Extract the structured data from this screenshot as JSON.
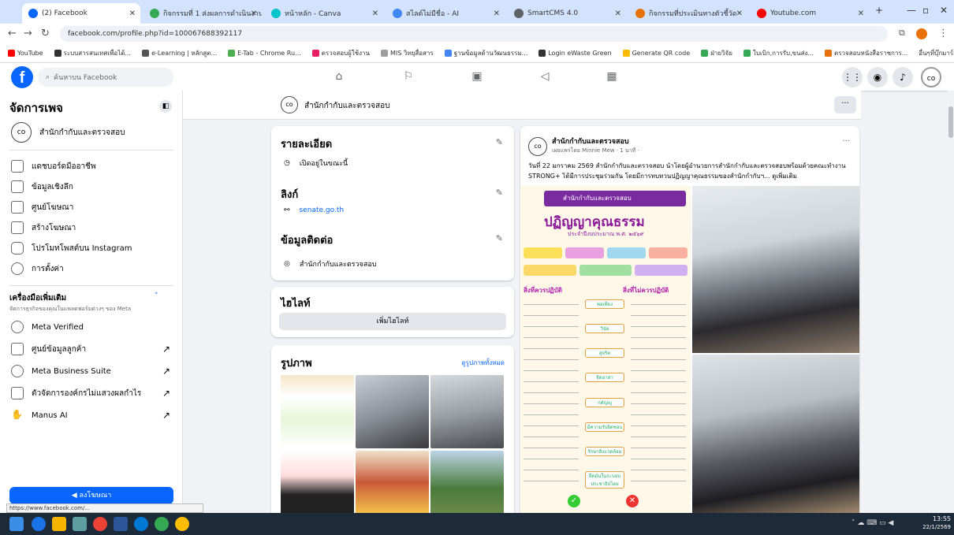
{
  "tabs": [
    {
      "label": "(2) Facebook"
    },
    {
      "label": "กิจกรรมที่ 1 ส่งผลการดำเนินงานเผยแพร่"
    },
    {
      "label": "หน้าหลัก - Canva"
    },
    {
      "label": "สไลด์ไม่มีชื่อ - AI"
    },
    {
      "label": "SmartCMS 4.0"
    },
    {
      "label": "กิจกรรมที่ประเมินทางตัวชี้วัด"
    },
    {
      "label": "Youtube.com"
    }
  ],
  "address": {
    "url": "facebook.com/profile.php?id=100067688392117"
  },
  "bookmarks": [
    "YouTube",
    "ระบบสารสนเทศเพื่อได้...",
    "e-Learning | หลักสูต...",
    "E-Tab - Chrome Ru...",
    "ตรวจสอบผู้ใช้งาน",
    "MIS วิทยุสื่อสาร",
    "ฐานข้อมูลด้านวัฒนธรรม...",
    "Login eWaste Green",
    "Generate QR code",
    "ฝ่ายวิจัย",
    "ใบเบิก,การรับ,ขนส่ง...",
    "ตรวจสอบหนังสือราชการ..."
  ],
  "bookmarks_other": "อื่นๆที่บุ๊กมาร์ก",
  "header": {
    "search_placeholder": "ค้นหาบน Facebook"
  },
  "sidebar": {
    "title": "จัดการเพจ",
    "page_name": "สำนักกำกับและตรวจสอบ",
    "items": [
      {
        "label": "แดชบอร์ดมืออาชีพ"
      },
      {
        "label": "ข้อมูลเชิงลึก"
      },
      {
        "label": "ศูนย์โฆษณา"
      },
      {
        "label": "สร้างโฆษณา"
      },
      {
        "label": "โปรโมทโพสต์บน Instagram"
      },
      {
        "label": "การตั้งค่า"
      }
    ],
    "tools_title": "เครื่องมือเพิ่มเติม",
    "tools_sub": "จัดการธุรกิจของคุณในแพลตฟอร์มต่างๆ ของ Meta",
    "tool_items": [
      {
        "label": "Meta Verified"
      },
      {
        "label": "ศูนย์ข้อมูลลูกค้า"
      },
      {
        "label": "Meta Business Suite"
      },
      {
        "label": "ตัวจัดการองค์กรไม่แสวงผลกำไร"
      },
      {
        "label": "Manus AI"
      }
    ],
    "advertise": "ลงโฆษณา"
  },
  "pagebar": {
    "name": "สำนักกำกับและตรวจสอบ"
  },
  "details": {
    "title": "รายละเอียด",
    "status": "เปิดอยู่ในขณะนี้",
    "links_title": "ลิงก์",
    "link": "senate.go.th",
    "contact_title": "ข้อมูลติดต่อ",
    "contact": "สำนักกำกับและตรวจสอบ"
  },
  "highlights": {
    "title": "ไฮไลท์",
    "button": "เพิ่มไฮไลท์"
  },
  "photos": {
    "title": "รูปภาพ",
    "see_all": "ดูรูปภาพทั้งหมด"
  },
  "post": {
    "author": "สำนักกำกับและตรวจสอบ",
    "meta": "เผยแพร่โดย Minnie Mew · 1 นาที ·",
    "text": "วันที่ 22 มกราคม 2569 สำนักกำกับและตรวจสอบ นำโดยผู้อำนวยการสำนักกำกับและตรวจสอบพร้อมด้วยคณะทำงาน STRONG+ ได้มีการประชุมร่วมกัน โดยมีการทบทวนปฏิญญาคุณธรรมของสำนักกำกับฯ... ดูเพิ่มเติม",
    "poster_header": "สำนักกำกับและตรวจสอบ",
    "poster_title": "ปฏิญญาคุณธรรม",
    "poster_sub": "ประจำปีงบประมาณ พ.ศ. ๒๕๖๙",
    "poster_left": "สิ่งที่ควรปฏิบัติ",
    "poster_right": "สิ่งที่ไม่ควรปฏิบัติ",
    "poster_values": [
      "พอเพียง",
      "วินัย",
      "สุจริต",
      "จิตอาสา",
      "กตัญญู",
      "มีความรับผิดชอบ",
      "รักษาสิ่งแวดล้อม",
      "ยึดมั่นในระบอบประชาธิปไตย"
    ]
  },
  "status_url": "https://www.facebook.com/...",
  "clock": {
    "time": "13:55",
    "date": "22/1/2569"
  },
  "colors": {
    "fb_blue": "#0866ff",
    "bg": "#f0f2f5"
  }
}
